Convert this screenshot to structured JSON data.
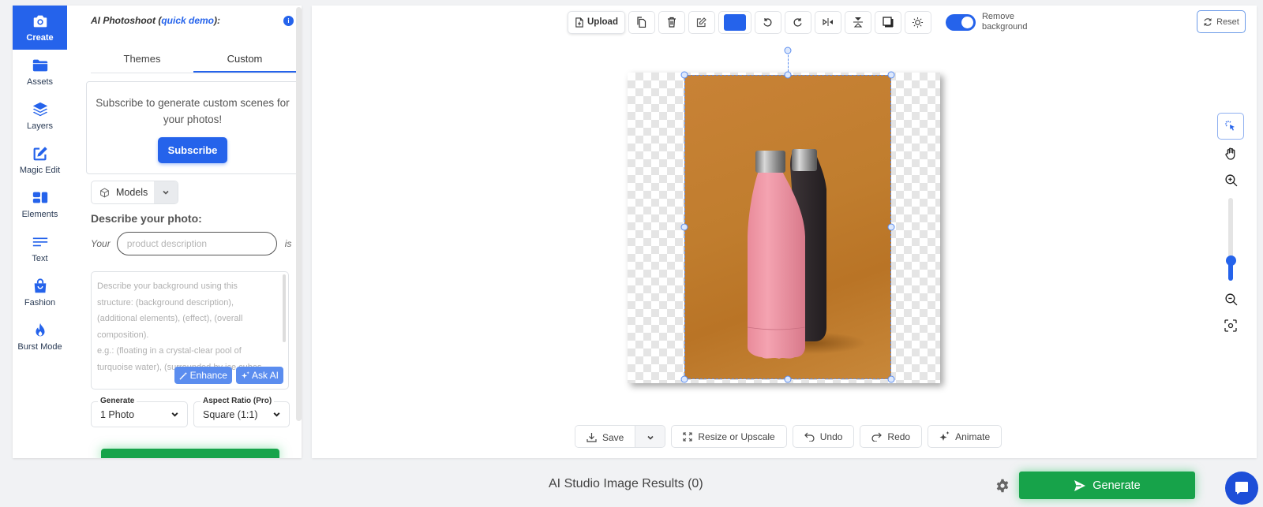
{
  "sidebar": {
    "items": [
      {
        "label": "Create",
        "icon": "camera-icon",
        "active": true
      },
      {
        "label": "Assets",
        "icon": "folder-icon"
      },
      {
        "label": "Layers",
        "icon": "layers-icon"
      },
      {
        "label": "Magic Edit",
        "icon": "edit-icon"
      },
      {
        "label": "Elements",
        "icon": "elements-icon"
      },
      {
        "label": "Text",
        "icon": "text-icon"
      },
      {
        "label": "Fashion",
        "icon": "shopping-bag-icon"
      },
      {
        "label": "Burst Mode",
        "icon": "fire-icon"
      }
    ]
  },
  "panel": {
    "title_prefix": "AI Photoshoot (",
    "title_link": "quick demo",
    "title_suffix": "):",
    "info_glyph": "i",
    "tabs": [
      {
        "label": "Themes"
      },
      {
        "label": "Custom",
        "active": true
      }
    ],
    "subscribe_text": "Subscribe to generate custom scenes for your photos!",
    "subscribe_button": "Subscribe",
    "models_label": "Models",
    "describe_label": "Describe your photo:",
    "your_label": "Your",
    "is_label": "is",
    "product_placeholder": "product description",
    "background_text": "Describe your background using this structure: (background description), (additional elements), (effect), (overall composition).\ne.g.: (floating in a crystal-clear pool of turquoise water), (surrounded by ice cubes",
    "enhance_button": "Enhance",
    "ask_ai_button": "Ask AI",
    "generate_select": {
      "label": "Generate",
      "value": "1 Photo"
    },
    "aspect_select": {
      "label": "Aspect Ratio (Pro)",
      "value": "Square (1:1)"
    }
  },
  "toolbar": {
    "upload": "Upload",
    "buttons": [
      "copy-icon",
      "trash-icon",
      "edit-icon",
      "color-swatch",
      "rotate-left-icon",
      "rotate-right-icon",
      "flip-horizontal-icon",
      "flip-vertical-icon",
      "shadow-icon",
      "brightness-icon"
    ],
    "fill_color": "#2563eb",
    "remove_bg_label_1": "Remove",
    "remove_bg_label_2": "background",
    "remove_bg_on": true,
    "reset": "Reset"
  },
  "side_tools": {
    "zoom_level": 0.25
  },
  "canvas": {
    "image_description": "pink and black insulated bottles on orange background"
  },
  "bottom_bar": {
    "save": "Save",
    "resize": "Resize or Upscale",
    "undo": "Undo",
    "redo": "Redo",
    "animate": "Animate"
  },
  "footer": {
    "results": "AI Studio Image Results (0)",
    "generate": "Generate"
  },
  "colors": {
    "accent": "#2563eb",
    "generate_green": "#17a34a"
  }
}
